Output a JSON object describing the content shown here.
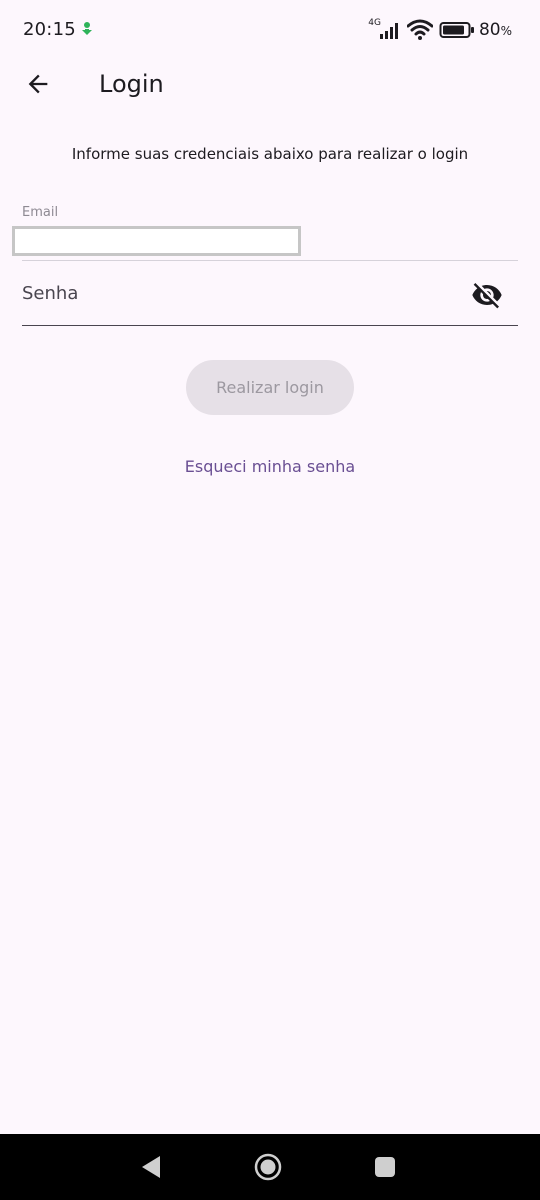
{
  "status_bar": {
    "time": "20:15",
    "network": "4G",
    "battery_percent": "80",
    "battery_suffix": "%",
    "icons": [
      "download-notification-icon",
      "signal-icon",
      "wifi-icon",
      "battery-icon"
    ]
  },
  "app_bar": {
    "title": "Login",
    "back_icon": "arrow-left-icon"
  },
  "form": {
    "subtitle": "Informe suas credenciais abaixo para realizar o login",
    "email_label": "Email",
    "email_value": "",
    "password_label": "Senha",
    "password_visibility_icon": "visibility-off-icon",
    "submit_label": "Realizar login",
    "forgot_label": "Esqueci minha senha"
  },
  "nav_bar": {
    "icons": [
      "triangle-back-icon",
      "circle-home-icon",
      "square-recents-icon"
    ]
  },
  "colors": {
    "background": "#fdf7fd",
    "primary": "#6a4f93",
    "button_disabled_bg": "#e6e0e7",
    "button_disabled_text": "#9c98a0",
    "nav_bar": "#000000"
  }
}
